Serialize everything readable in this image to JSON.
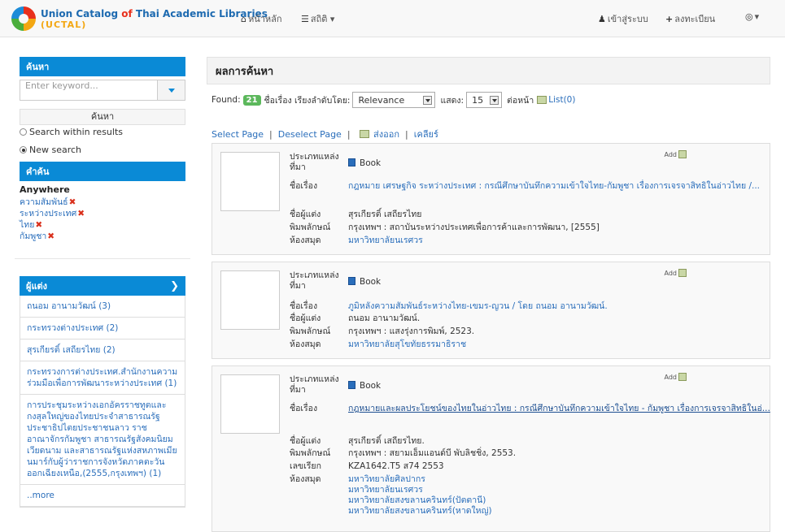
{
  "nav": {
    "brand_line1_a": "Union Catalog",
    "brand_line1_of": "of",
    "brand_line1_b": "Thai Academic Libraries",
    "brand_line2": "(UCTAL)",
    "home": "หน้าหลัก",
    "stats": "สถิติ ▾",
    "login": "เข้าสู่ระบบ",
    "register": "ลงทะเบียน",
    "lang": "▾"
  },
  "sidebar": {
    "search_title": "ค้นหา",
    "search_placeholder": "Enter keyword...",
    "search_button": "ค้นหา",
    "within_results": "Search within results",
    "new_search": "New search",
    "terms_title": "คำค้น",
    "terms_field": "Anywhere",
    "terms": [
      "ความสัมพันธ์",
      "ระหว่างประเทศ",
      "ไทย",
      "กัมพูชา"
    ],
    "authors_title": "ผู้แต่ง",
    "authors": [
      "ถนอม อานามวัฒน์ (3)",
      "กระทรวงต่างประเทศ (2)",
      "สุรเกียรติ์ เสถียรไทย (2)",
      "กระทรวงการต่างประเทศ.สำนักงานความร่วมมือเพื่อการพัฒนาระหว่างประเทศ (1)",
      "การประชุมระหว่างเอกอัครราชทูตและกงสุลใหญ่ของไทยประจำสาธารณรัฐประชาธิปไตยประชาชนลาว ราชอาณาจักรกัมพูชา สาธารณรัฐสังคมนิยมเวียดนาม และสาธารณรัฐแห่งสหภาพเมียนมาร์กับผู้ว่าราชการจังหวัดภาคตะวันออกเฉียงเหนือ,(2555,กรุงเทพฯ) (1)",
      "..more"
    ]
  },
  "results": {
    "title": "ผลการค้นหา",
    "found_label": "Found:",
    "found_count": "21",
    "sort_label": "ชื่อเรื่อง เรียงลำดับโดย:",
    "sort_value": "Relevance",
    "show_label": "แสดง:",
    "show_value": "15",
    "per_page": "ต่อหน้า",
    "list_label": "List(0)",
    "select_page": "Select Page",
    "deselect_page": "Deselect Page",
    "export": "ส่งออก",
    "clear": "เคลียร์",
    "add_label": "Add",
    "labels": {
      "type": "ประเภทแหล่งที่มา",
      "title": "ชื่อเรื่อง",
      "author": "ชื่อผู้แต่ง",
      "publisher": "พิมพลักษณ์",
      "callno": "เลขเรียก",
      "library": "ห้องสมุด"
    },
    "items": [
      {
        "type": "Book",
        "title": "กฎหมาย เศรษฐกิจ ระหว่างประเทศ : กรณีศึกษาบันทึกความเข้าใจไทย-กัมพูชา เรื่องการเจรจาสิทธิในอ่าวไทย /...",
        "author": "สุรเกียรติ์ เสถียรไทย",
        "publisher": "กรุงเทพฯ : สถาบันระหว่างประเทศเพื่อการค้าและการพัฒนา, [2555]",
        "libraries": [
          "มหาวิทยาลัยนเรศวร"
        ]
      },
      {
        "type": "Book",
        "title": "ภูมิหลังความสัมพันธ์ระหว่างไทย-เขมร-ญวน / โดย ถนอม อานามวัฒน์.",
        "author": "ถนอม อานามวัฒน์.",
        "publisher": "กรุงเทพฯ : แสงรุ่งการพิมพ์, 2523.",
        "libraries": [
          "มหาวิทยาลัยสุโขทัยธรรมาธิราช"
        ]
      },
      {
        "type": "Book",
        "title": "กฎหมายและผลประโยชน์ของไทยในอ่าวไทย : กรณีศึกษาบันทึกความเข้าใจไทย - กัมพูชา เรื่องการเจรจาสิทธิในอ่...",
        "author": "สุรเกียรติ์ เสถียรไทย.",
        "publisher": "กรุงเทพฯ : สยามเอ็มแอนด์บี พับลิชชิ่ง, 2553.",
        "callno": "KZA1642.T5 ส74 2553",
        "libraries": [
          "มหาวิทยาลัยศิลปากร",
          "มหาวิทยาลัยนเรศวร",
          "มหาวิทยาลัยสงขลานครินทร์(ปัตตานี)",
          "มหาวิทยาลัยสงขลานครินทร์(หาดใหญ่)"
        ]
      }
    ]
  }
}
